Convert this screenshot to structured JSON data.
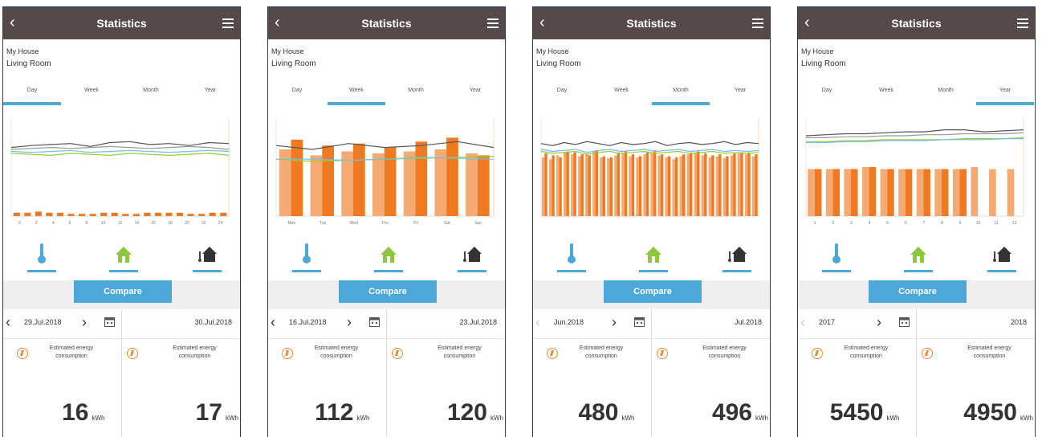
{
  "header": {
    "title": "Statistics",
    "back_icon": "chevron-left-icon",
    "menu_icon": "hamburger-menu-icon"
  },
  "location": {
    "house": "My House",
    "room": "Living Room"
  },
  "tabs": [
    "Day",
    "Week",
    "Month",
    "Year"
  ],
  "compare_label": "Compare",
  "energy_label": "Estimated energy consumption",
  "unit": "kWh",
  "colors": {
    "header": "#55494a",
    "accent": "#4ba8d9",
    "bar": "#ef7a22",
    "bar_light": "#f4aa72",
    "line_black": "#555555",
    "line_green": "#9acd32",
    "line_blue": "#6cc3e8"
  },
  "screens": [
    {
      "active_tab": "Day",
      "left": {
        "date": "29.Jul.2018",
        "value": "16"
      },
      "right": {
        "date": "30.Jul.2018",
        "value": "17"
      },
      "prev_disabled": false
    },
    {
      "active_tab": "Week",
      "left": {
        "date": "16.Jul.2018",
        "value": "112"
      },
      "right": {
        "date": "23.Jul.2018",
        "value": "120"
      },
      "prev_disabled": false
    },
    {
      "active_tab": "Month",
      "left": {
        "date": "Jun.2018",
        "value": "480"
      },
      "right": {
        "date": "Jul.2018",
        "value": "496"
      },
      "prev_disabled": true
    },
    {
      "active_tab": "Year",
      "left": {
        "date": "2017",
        "value": "5450"
      },
      "right": {
        "date": "2018",
        "value": "4950"
      },
      "prev_disabled": true
    }
  ],
  "chart_data": [
    {
      "type": "bar",
      "period": "day",
      "categories": [
        "0",
        "2",
        "4",
        "6",
        "8",
        "10",
        "12",
        "14",
        "16",
        "18",
        "20",
        "22",
        "24"
      ],
      "bar_values": [
        3,
        3,
        4,
        3,
        3,
        2,
        2,
        2,
        3,
        3,
        2,
        2,
        3,
        3,
        3,
        3,
        2,
        2,
        3,
        3
      ],
      "lines": {
        "black": [
          70,
          72,
          73,
          74,
          71,
          75,
          76,
          73,
          74,
          72,
          75,
          74
        ],
        "gray": [
          68,
          69,
          70,
          69,
          70,
          71,
          70,
          69,
          70,
          71,
          70,
          68
        ],
        "green": [
          64,
          63,
          62,
          64,
          63,
          62,
          64,
          63,
          62,
          63,
          64,
          62
        ],
        "blue": [
          66,
          65,
          66,
          67,
          65,
          66,
          67,
          66,
          65,
          66,
          67,
          66
        ]
      }
    },
    {
      "type": "bar",
      "period": "week",
      "categories": [
        "Mon",
        "Tue",
        "Wed",
        "Thu",
        "Fri",
        "Sat",
        "Sun"
      ],
      "bar_values_prev": [
        68,
        62,
        66,
        64,
        66,
        68,
        64
      ],
      "bar_values_curr": [
        78,
        72,
        74,
        70,
        76,
        80,
        62
      ],
      "lines": {
        "black": [
          72,
          68,
          74,
          70,
          72,
          76,
          70
        ],
        "green": [
          58,
          56,
          57,
          58,
          59,
          60,
          61
        ],
        "blue": [
          58,
          58,
          57,
          58,
          60,
          59,
          58
        ]
      }
    },
    {
      "type": "bar",
      "period": "month",
      "bar_values_prev": [
        60,
        58,
        62,
        65,
        63,
        61,
        64,
        66,
        60,
        59,
        62,
        64,
        61,
        60,
        63,
        65,
        62,
        60,
        58,
        61,
        63,
        65,
        62,
        60,
        61,
        59,
        62,
        64,
        63,
        61
      ],
      "bar_values_curr": [
        64,
        62,
        60,
        66,
        65,
        63,
        62,
        67,
        61,
        60,
        64,
        66,
        63,
        61,
        65,
        67,
        63,
        61,
        60,
        63,
        64,
        66,
        64,
        62,
        63,
        61,
        64,
        65,
        65,
        63
      ],
      "lines": {
        "black": [
          74,
          72,
          75,
          73,
          76,
          74,
          72,
          75,
          73,
          74,
          76,
          72,
          74,
          75,
          73,
          74,
          76,
          73,
          75,
          74
        ],
        "green": [
          66,
          64,
          65,
          66,
          63,
          65,
          66,
          64,
          65,
          66,
          64,
          65,
          66,
          64,
          65,
          66,
          64,
          65,
          64,
          65
        ],
        "blue": [
          68,
          66,
          67,
          68,
          65,
          67,
          68,
          66,
          67,
          68,
          66,
          67,
          68,
          66,
          67,
          68,
          66,
          67,
          66,
          67
        ]
      }
    },
    {
      "type": "bar",
      "period": "year",
      "categories": [
        "1",
        "2",
        "3",
        "4",
        "5",
        "6",
        "7",
        "8",
        "9",
        "10",
        "11",
        "12"
      ],
      "bar_values_prev": [
        48,
        48,
        48,
        50,
        48,
        48,
        48,
        48,
        48,
        50,
        48,
        48
      ],
      "bar_values_curr": [
        48,
        48,
        48,
        50,
        48,
        48,
        48,
        48,
        48,
        0,
        0,
        0
      ],
      "lines": {
        "black": [
          82,
          83,
          84,
          84,
          85,
          86,
          86,
          88,
          88,
          86,
          87,
          88
        ],
        "gray": [
          80,
          80,
          81,
          81,
          82,
          82,
          83,
          83,
          84,
          84,
          84,
          85
        ],
        "green": [
          76,
          76,
          77,
          77,
          78,
          78,
          78,
          78,
          79,
          79,
          79,
          80
        ],
        "blue": [
          75,
          75,
          76,
          76,
          77,
          77,
          77,
          78,
          78,
          78,
          79,
          79
        ]
      }
    }
  ]
}
